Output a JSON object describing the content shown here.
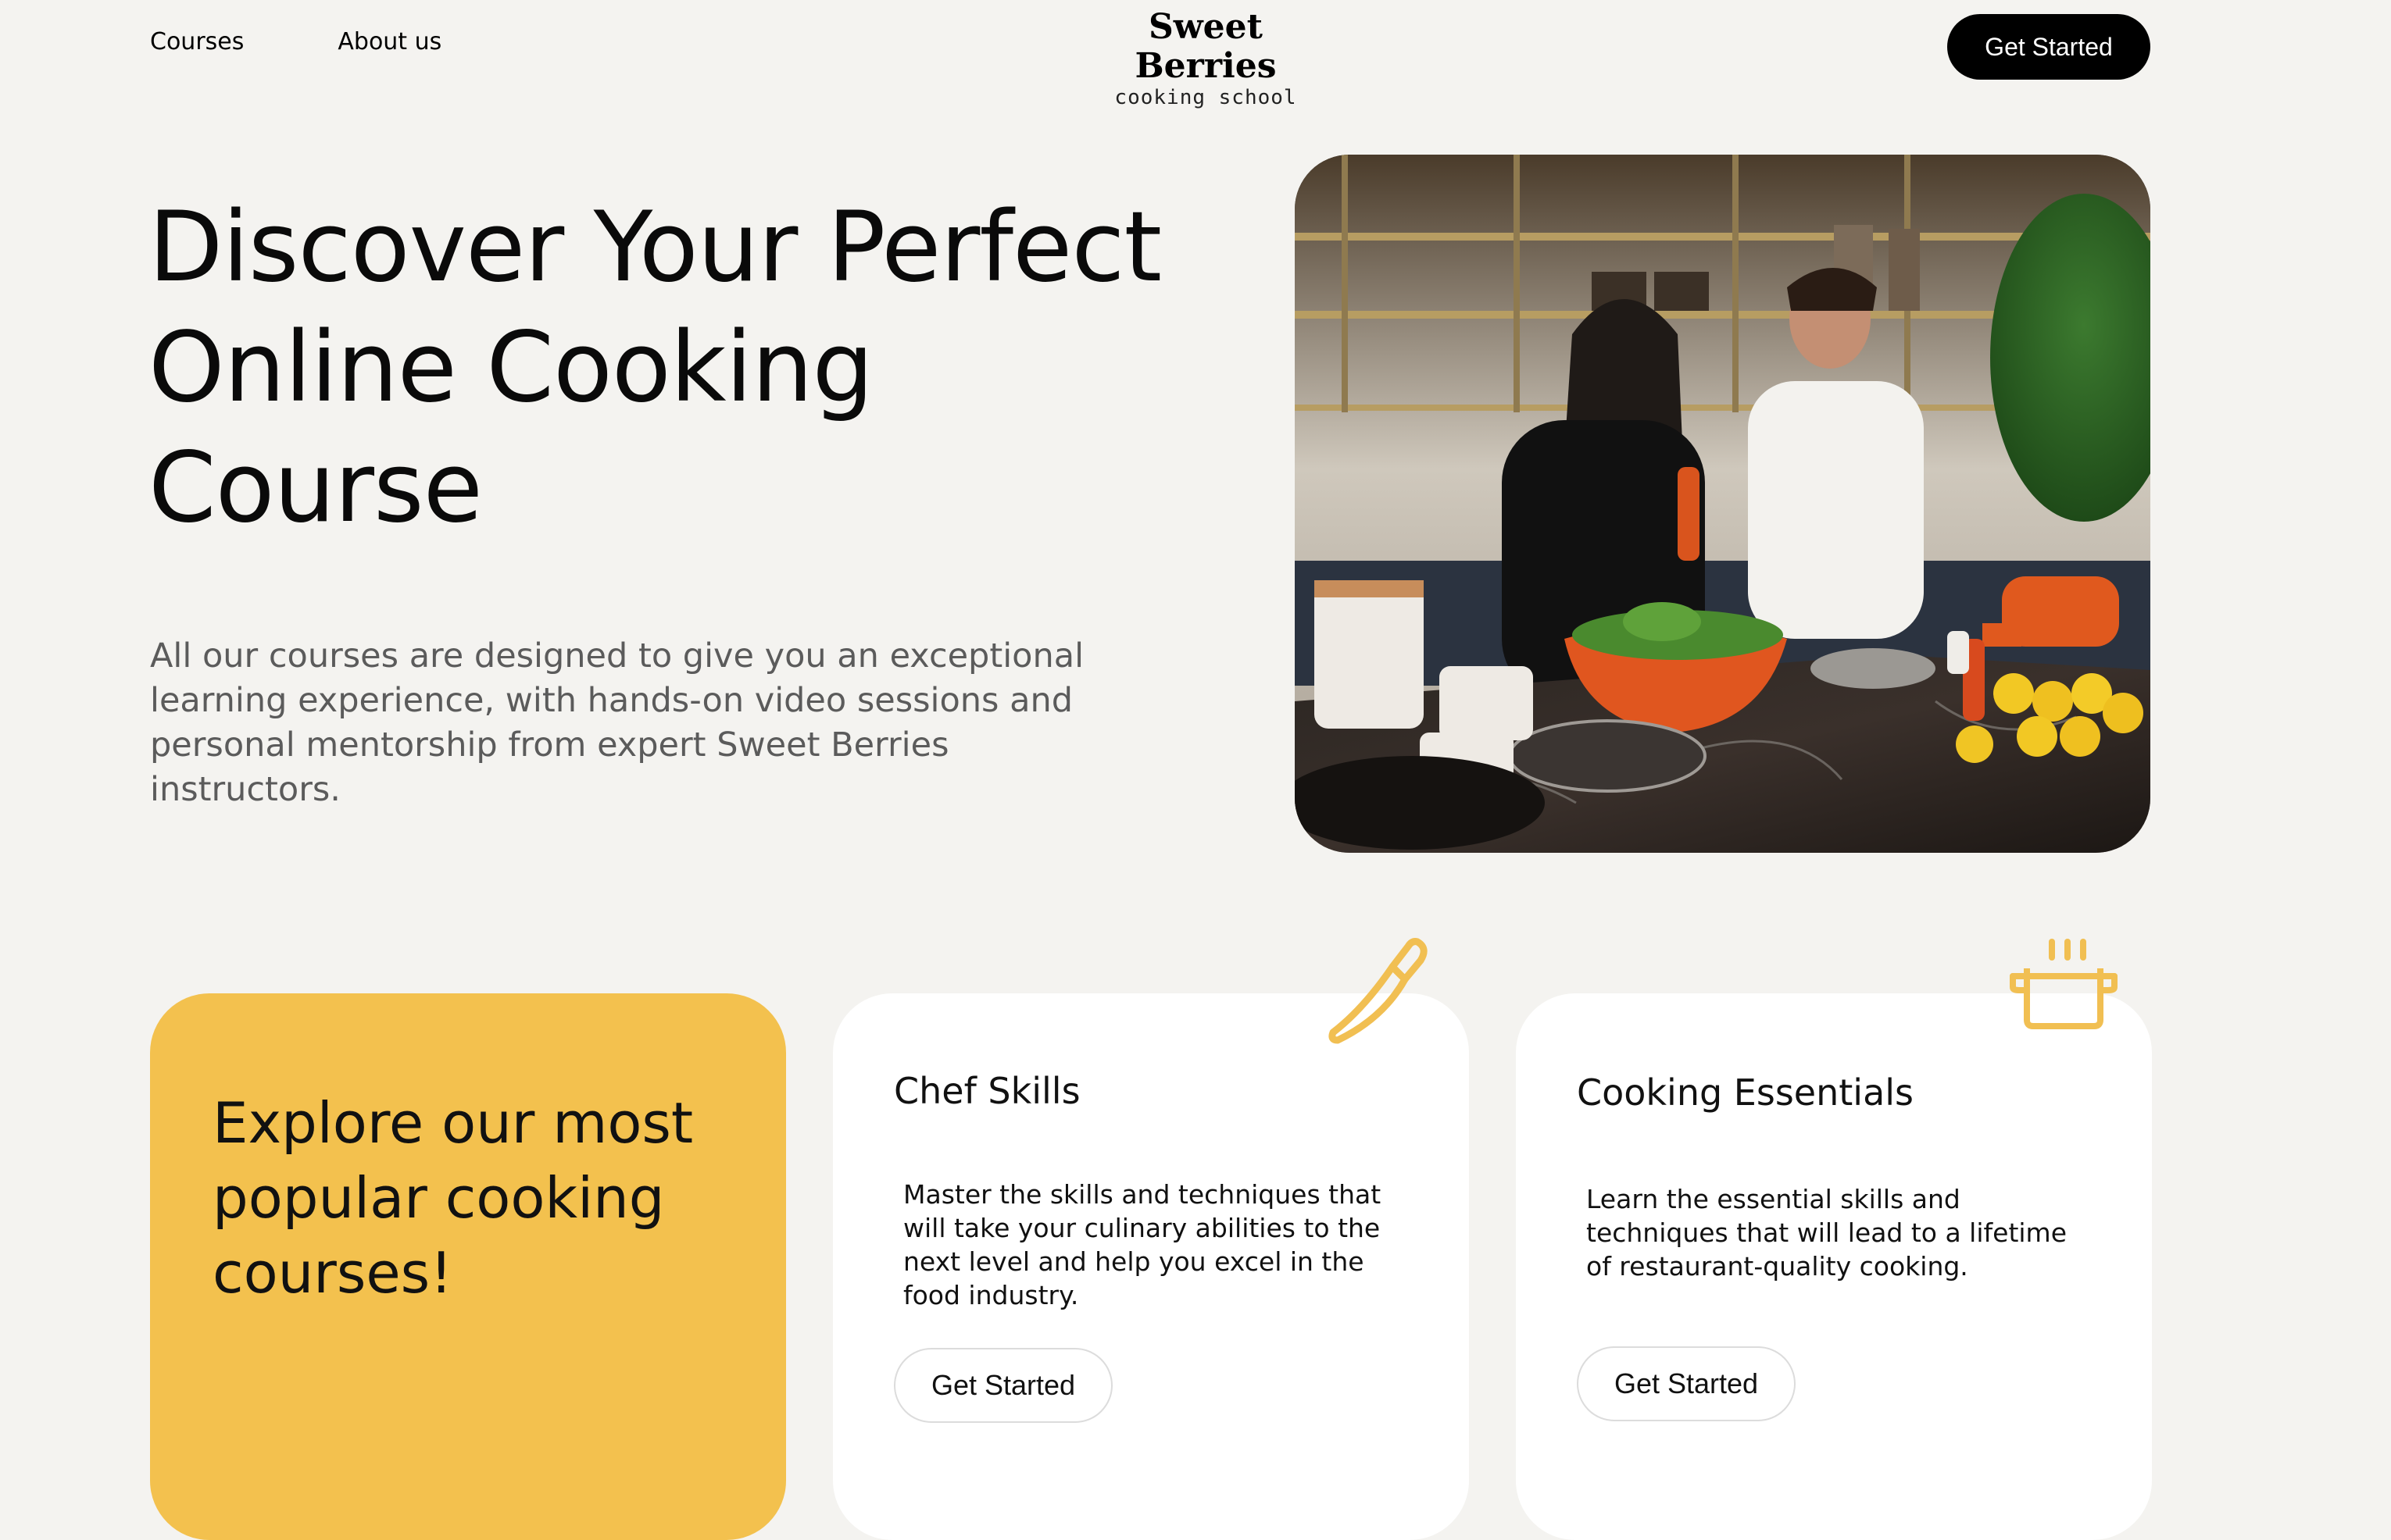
{
  "header": {
    "nav": [
      "Courses",
      "About us"
    ],
    "logo_main": "Sweet Berries",
    "logo_sub": "cooking school",
    "cta_label": "Get Started"
  },
  "hero": {
    "title": "Discover Your Perfect Online Cooking Course",
    "description": "All our courses are designed to give you an exceptional learning experience, with hands-on video sessions and personal mentorship from expert Sweet Berries instructors.",
    "image": "photo of two people cooking in a kitchen"
  },
  "cards": {
    "promo": {
      "text": "Explore our most popular cooking courses!"
    },
    "chef": {
      "title": "Chef Skills",
      "description": "Master the skills and techniques that will take your culinary abilities to the next level and help you excel in the food industry.",
      "button": "Get Started",
      "icon": "knife-icon"
    },
    "essentials": {
      "title": "Cooking Essentials",
      "description": "Learn the essential skills and techniques that will lead to a lifetime of restaurant-quality cooking.",
      "button": "Get Started",
      "icon": "pot-icon"
    }
  },
  "colors": {
    "background": "#f4f3f0",
    "accent_yellow": "#f3c14e",
    "icon_yellow": "#f1bf52",
    "button_black": "#000000",
    "card_white": "#ffffff"
  }
}
